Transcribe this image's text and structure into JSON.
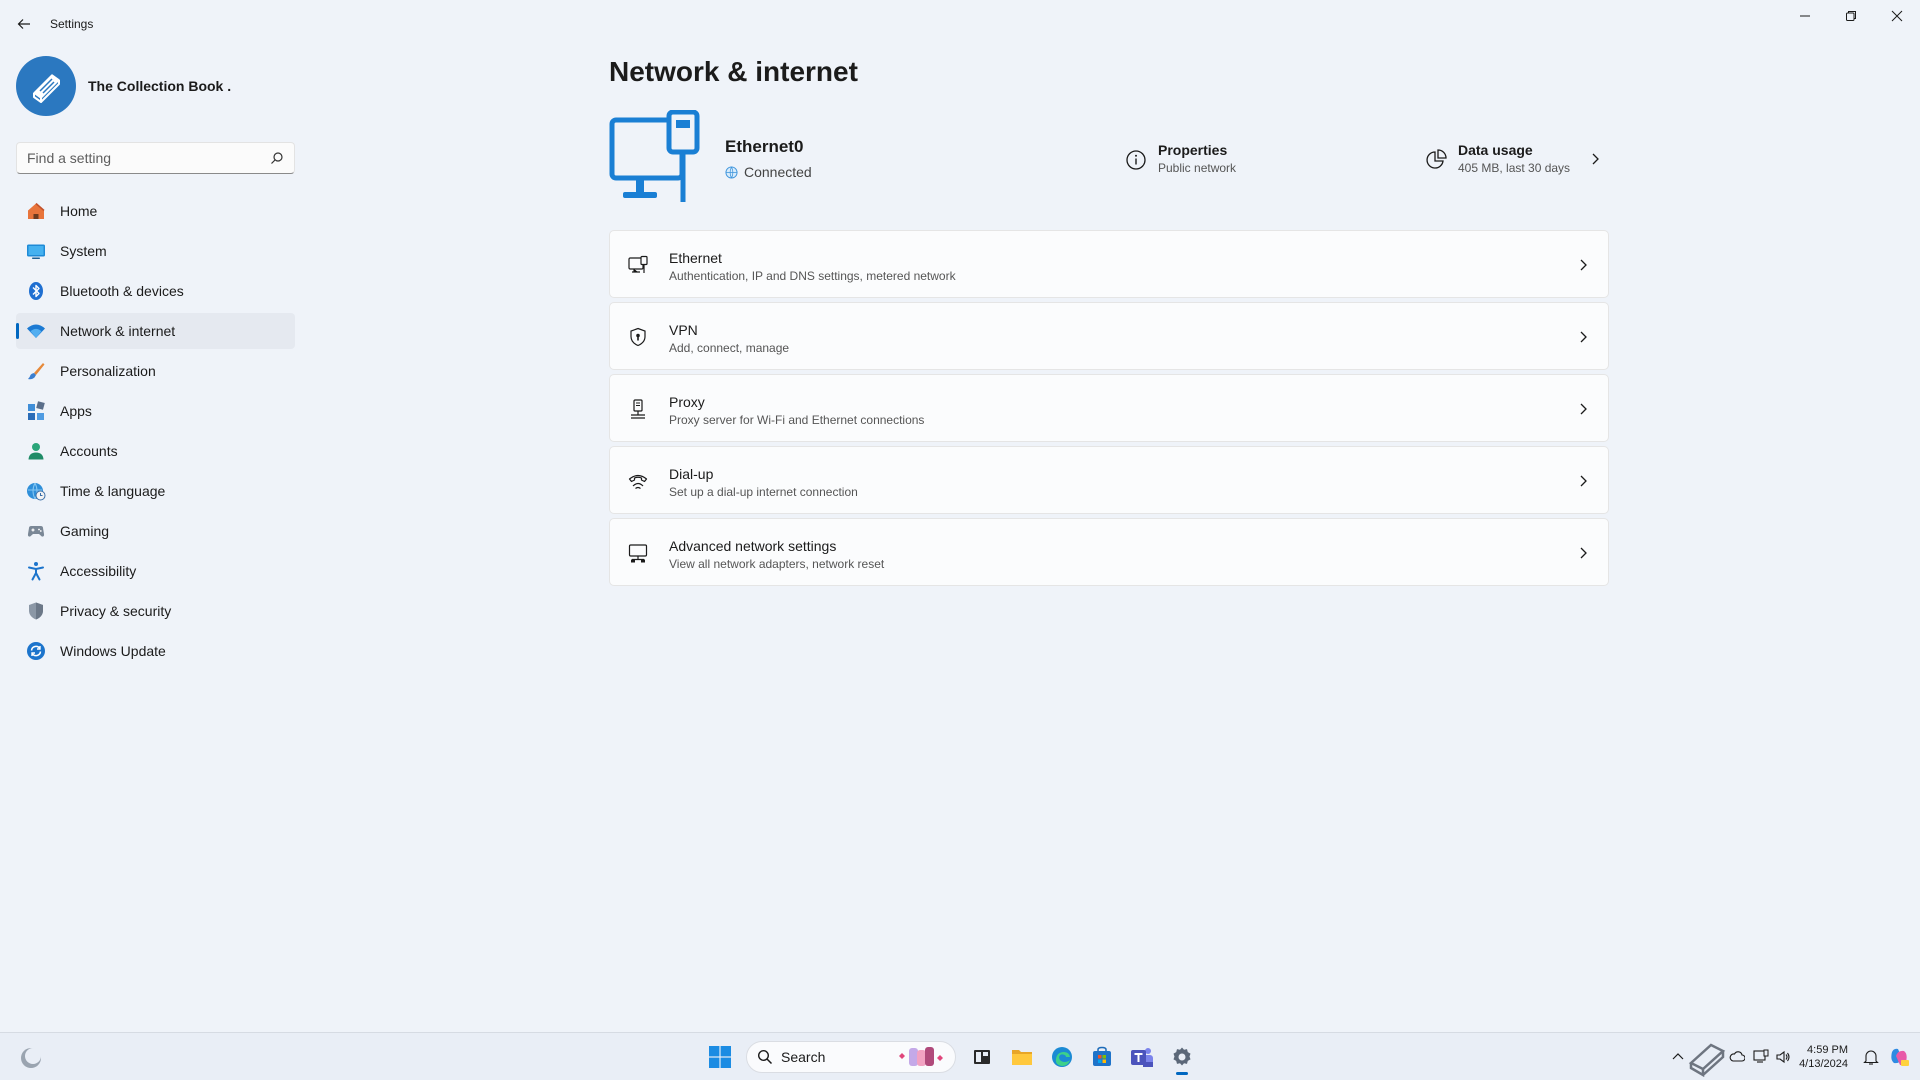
{
  "app": {
    "title": "Settings"
  },
  "profile": {
    "name": "The Collection Book ."
  },
  "search": {
    "placeholder": "Find a setting"
  },
  "nav": {
    "items": [
      {
        "label": "Home",
        "icon": "home-icon"
      },
      {
        "label": "System",
        "icon": "system-icon"
      },
      {
        "label": "Bluetooth & devices",
        "icon": "bluetooth-icon"
      },
      {
        "label": "Network & internet",
        "icon": "wifi-icon",
        "active": true
      },
      {
        "label": "Personalization",
        "icon": "brush-icon"
      },
      {
        "label": "Apps",
        "icon": "apps-icon"
      },
      {
        "label": "Accounts",
        "icon": "accounts-icon"
      },
      {
        "label": "Time & language",
        "icon": "globe-clock-icon"
      },
      {
        "label": "Gaming",
        "icon": "gamepad-icon"
      },
      {
        "label": "Accessibility",
        "icon": "accessibility-icon"
      },
      {
        "label": "Privacy & security",
        "icon": "shield-icon"
      },
      {
        "label": "Windows Update",
        "icon": "update-icon"
      }
    ]
  },
  "main": {
    "title": "Network & internet",
    "hero": {
      "name": "Ethernet0",
      "status": "Connected",
      "properties": {
        "title": "Properties",
        "subtitle": "Public network"
      },
      "usage": {
        "title": "Data usage",
        "subtitle": "405 MB, last 30 days"
      }
    },
    "cards": [
      {
        "title": "Ethernet",
        "subtitle": "Authentication, IP and DNS settings, metered network",
        "icon": "ethernet-icon"
      },
      {
        "title": "VPN",
        "subtitle": "Add, connect, manage",
        "icon": "vpn-shield-icon"
      },
      {
        "title": "Proxy",
        "subtitle": "Proxy server for Wi-Fi and Ethernet connections",
        "icon": "proxy-icon"
      },
      {
        "title": "Dial-up",
        "subtitle": "Set up a dial-up internet connection",
        "icon": "dialup-icon"
      },
      {
        "title": "Advanced network settings",
        "subtitle": "View all network adapters, network reset",
        "icon": "advanced-network-icon"
      }
    ]
  },
  "taskbar": {
    "search_label": "Search",
    "time": "4:59 PM",
    "date": "4/13/2024"
  },
  "colors": {
    "accent": "#0067c0",
    "hero_blue": "#1a7fd4"
  }
}
